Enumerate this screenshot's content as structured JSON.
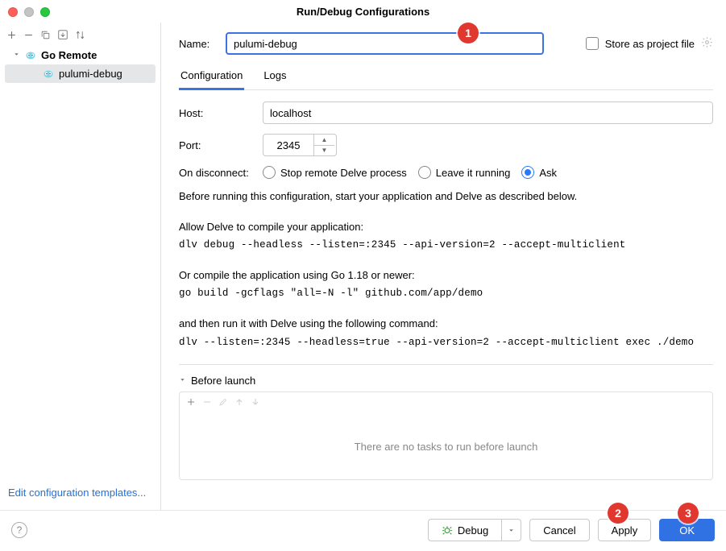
{
  "title": "Run/Debug Configurations",
  "tree": {
    "parent": "Go Remote",
    "child": "pulumi-debug"
  },
  "edit_templates": "Edit configuration templates...",
  "form": {
    "name_label": "Name:",
    "name_value": "pulumi-debug",
    "store_project": "Store as project file",
    "tabs": {
      "configuration": "Configuration",
      "logs": "Logs"
    },
    "host_label": "Host:",
    "host_value": "localhost",
    "port_label": "Port:",
    "port_value": "2345",
    "disconnect_label": "On disconnect:",
    "disconnect_opts": {
      "stop": "Stop remote Delve process",
      "leave": "Leave it running",
      "ask": "Ask"
    },
    "instr_intro": "Before running this configuration, start your application and Delve as described below.",
    "instr_allow": "Allow Delve to compile your application:",
    "instr_cmd1": "dlv debug --headless --listen=:2345 --api-version=2 --accept-multiclient",
    "instr_or": "Or compile the application using Go 1.18 or newer:",
    "instr_cmd2": "go build -gcflags \"all=-N -l\" github.com/app/demo",
    "instr_then": "and then run it with Delve using the following command:",
    "instr_cmd3": "dlv --listen=:2345 --headless=true --api-version=2 --accept-multiclient exec ./demo",
    "before_launch": "Before launch",
    "no_tasks": "There are no tasks to run before launch"
  },
  "buttons": {
    "debug": "Debug",
    "cancel": "Cancel",
    "apply": "Apply",
    "ok": "OK"
  },
  "callouts": {
    "c1": "1",
    "c2": "2",
    "c3": "3"
  }
}
